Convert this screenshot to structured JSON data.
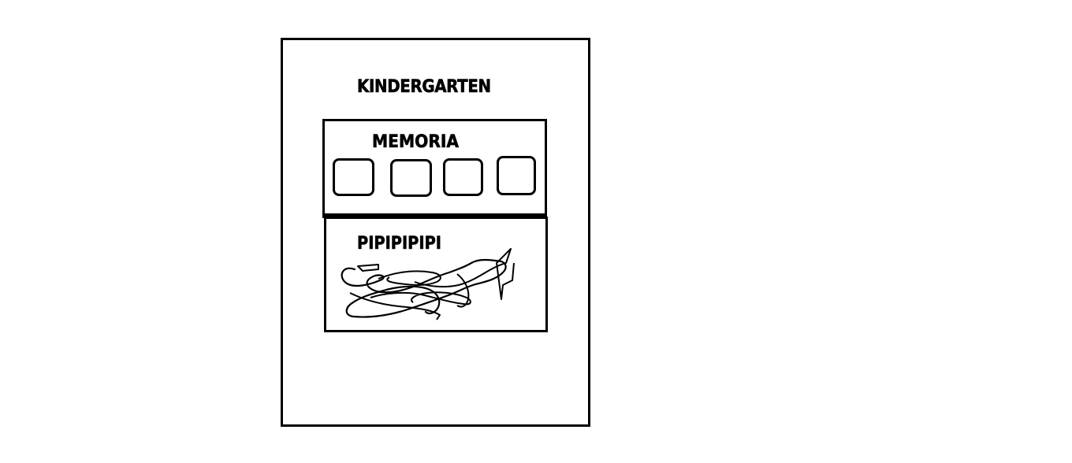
{
  "page": {
    "title": "KINDERGARTEN"
  },
  "memory_section": {
    "title": "MEMORIA",
    "slots": [
      "",
      "",
      "",
      ""
    ]
  },
  "drawing_section": {
    "title": "PIPIPIPIPI"
  },
  "colors": {
    "background": "#ffffff",
    "ink": "#000000"
  }
}
